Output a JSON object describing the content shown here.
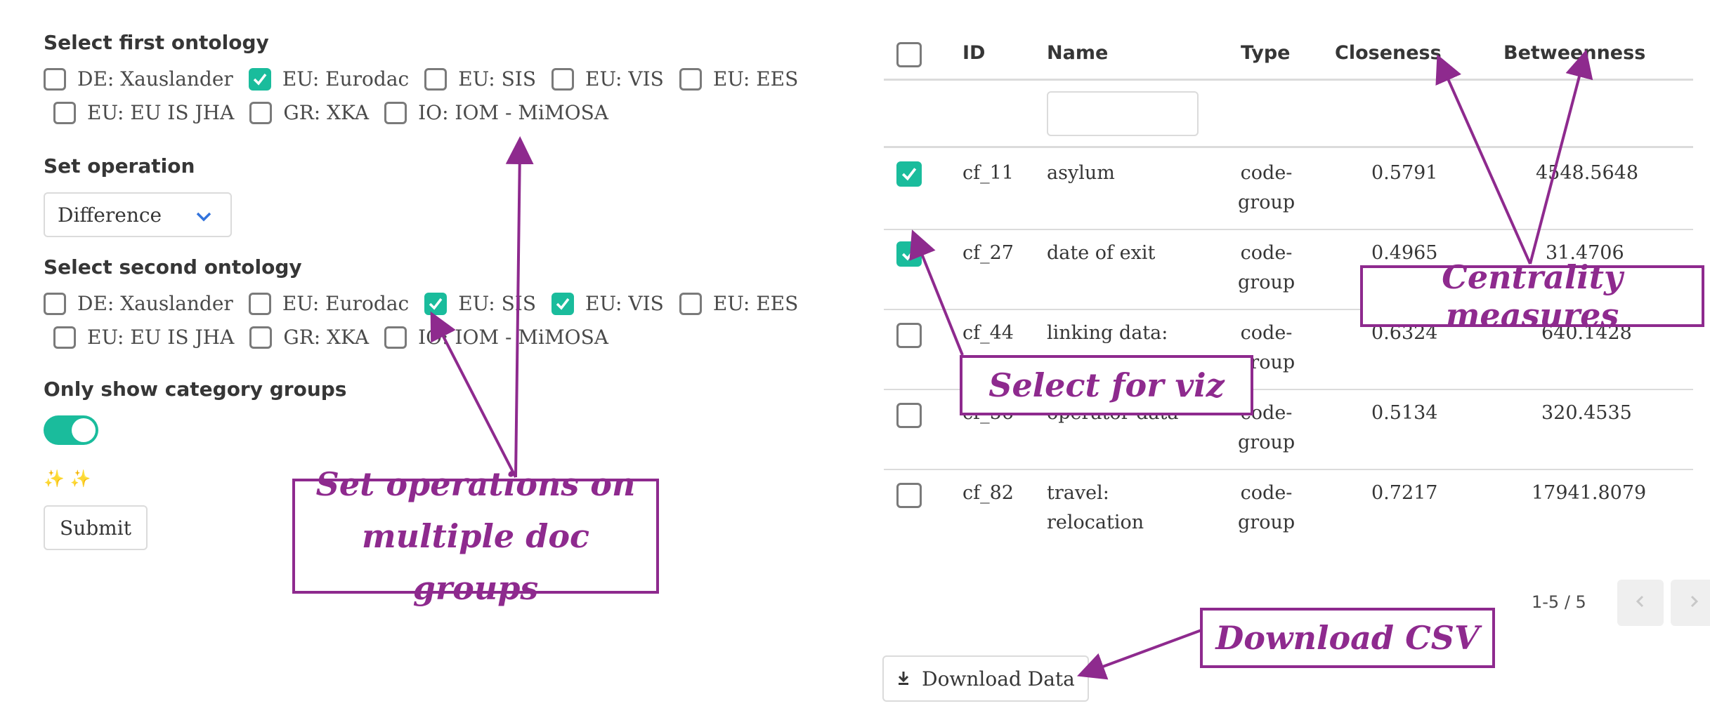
{
  "left": {
    "first_heading": "Select first ontology",
    "first_options": [
      {
        "label": "DE: Xauslander",
        "checked": false
      },
      {
        "label": "EU: Eurodac",
        "checked": true
      },
      {
        "label": "EU: SIS",
        "checked": false
      },
      {
        "label": "EU: VIS",
        "checked": false
      },
      {
        "label": "EU: EES",
        "checked": false
      },
      {
        "label": "EU: EU IS JHA",
        "checked": false
      },
      {
        "label": "GR: XKA",
        "checked": false
      },
      {
        "label": "IO: IOM - MiMOSA",
        "checked": false
      }
    ],
    "operation_heading": "Set operation",
    "operation_value": "Difference",
    "second_heading": "Select second ontology",
    "second_options": [
      {
        "label": "DE: Xauslander",
        "checked": false
      },
      {
        "label": "EU: Eurodac",
        "checked": false
      },
      {
        "label": "EU: SIS",
        "checked": true
      },
      {
        "label": "EU: VIS",
        "checked": true
      },
      {
        "label": "EU: EES",
        "checked": false
      },
      {
        "label": "EU: EU IS JHA",
        "checked": false
      },
      {
        "label": "GR: XKA",
        "checked": false
      },
      {
        "label": "IO: IOM - MiMOSA",
        "checked": false
      }
    ],
    "category_heading": "Only show category groups",
    "category_toggle_on": true,
    "sparkles": "✨ ✨",
    "submit_label": "Submit"
  },
  "table": {
    "columns": [
      "ID",
      "Name",
      "Type",
      "Closeness",
      "Betweenness"
    ],
    "name_filter_value": "",
    "rows": [
      {
        "selected": true,
        "id": "cf_11",
        "name": [
          "asylum"
        ],
        "type": [
          "code-",
          "group"
        ],
        "closeness": "0.5791",
        "betweenness": "4548.5648"
      },
      {
        "selected": true,
        "id": "cf_27",
        "name": [
          "date of exit"
        ],
        "type": [
          "code-",
          "group"
        ],
        "closeness": "0.4965",
        "betweenness": "31.4706"
      },
      {
        "selected": false,
        "id": "cf_44",
        "name": [
          "linking data:"
        ],
        "type": [
          "code-",
          "group"
        ],
        "closeness": "0.6324",
        "betweenness": "640.1428"
      },
      {
        "selected": false,
        "id": "cf_56",
        "name": [
          "operator data"
        ],
        "type": [
          "code-",
          "group"
        ],
        "closeness": "0.5134",
        "betweenness": "320.4535"
      },
      {
        "selected": false,
        "id": "cf_82",
        "name": [
          "travel:",
          "relocation"
        ],
        "type": [
          "code-",
          "group"
        ],
        "closeness": "0.7217",
        "betweenness": "17941.8079"
      }
    ],
    "pagination_text": "1-5 / 5",
    "download_label": "Download Data"
  },
  "annotations": {
    "set_operations": [
      "Set operations on",
      "multiple doc groups"
    ],
    "select_for_viz": "Select for viz",
    "centrality": "Centrality measures",
    "download_csv": "Download CSV"
  },
  "colors": {
    "accent": "#1abc9c",
    "annotation": "#8e2a8e"
  }
}
